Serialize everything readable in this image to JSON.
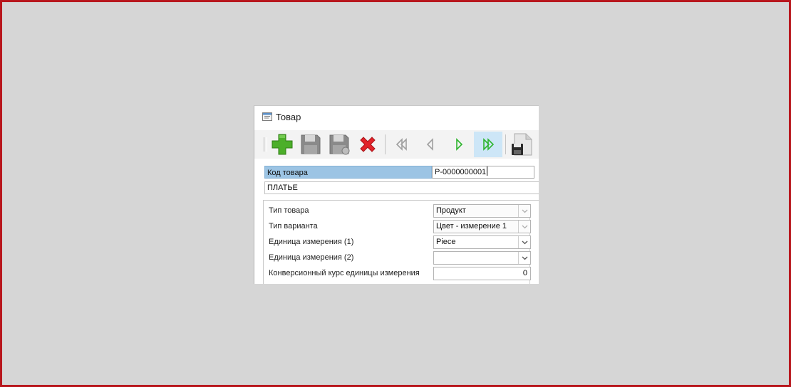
{
  "window": {
    "title": "Товар",
    "icon": "window-form-icon"
  },
  "toolbar": {
    "buttons": [
      {
        "icon": "add-plus-icon",
        "color": "#4caf2a"
      },
      {
        "icon": "save-disk-icon",
        "color": "#8a8a8a"
      },
      {
        "icon": "save-as-disk-icon",
        "color": "#8a8a8a"
      },
      {
        "icon": "delete-x-icon",
        "color": "#e2232a"
      },
      {
        "icon": "first-record-icon",
        "color": "#a0a0a0"
      },
      {
        "icon": "previous-record-icon",
        "color": "#a0a0a0"
      },
      {
        "icon": "next-record-icon",
        "color": "#2fb52f"
      },
      {
        "icon": "last-record-icon",
        "color": "#2fb52f"
      },
      {
        "icon": "save-document-icon",
        "color": "#333333"
      }
    ]
  },
  "form": {
    "code_label": "Код товара",
    "code_value": "P-0000000001",
    "name_value": "ПЛАТЬЕ",
    "fields": {
      "product_type": {
        "label": "Тип товара",
        "value": "Продукт"
      },
      "variant_type": {
        "label": "Тип варианта",
        "value": "Цвет - измерение 1"
      },
      "unit1": {
        "label": "Единица измерения (1)",
        "value": "Piece"
      },
      "unit2": {
        "label": "Единица измерения (2)",
        "value": ""
      },
      "conversion": {
        "label": "Конверсионный курс единицы измерения",
        "value": "0"
      }
    }
  },
  "colors": {
    "frame_border": "#b8171d",
    "highlight_label": "#9cc4e4",
    "active_button": "#cde6f7"
  }
}
